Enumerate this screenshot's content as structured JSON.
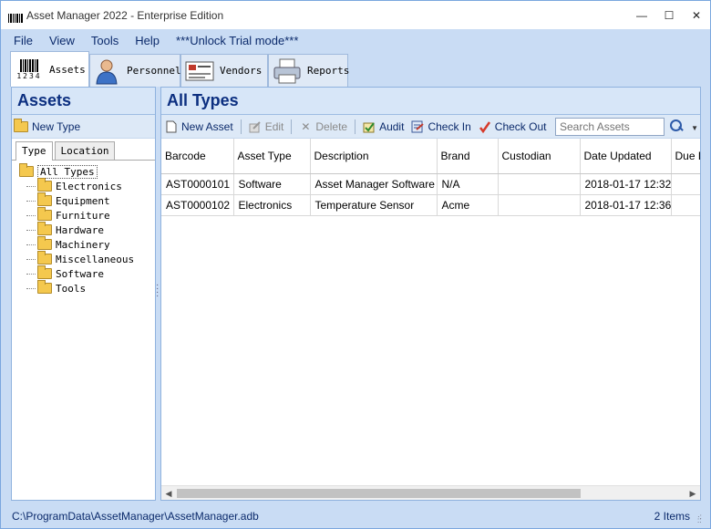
{
  "window": {
    "title": "Asset Manager 2022 - Enterprise Edition",
    "controls": {
      "minimize": "—",
      "maximize": "☐",
      "close": "✕"
    }
  },
  "menu": [
    "File",
    "View",
    "Tools",
    "Help",
    "***Unlock Trial mode***"
  ],
  "main_tabs": [
    {
      "label": "Assets",
      "icon": "barcode-icon",
      "active": true,
      "icon_text": "1234"
    },
    {
      "label": "Personnel",
      "icon": "person-icon",
      "active": false
    },
    {
      "label": "Vendors",
      "icon": "vendor-card-icon",
      "active": false
    },
    {
      "label": "Reports",
      "icon": "printer-icon",
      "active": false
    }
  ],
  "left_pane": {
    "title": "Assets",
    "new_type_label": "New Type",
    "subtabs": [
      {
        "label": "Type",
        "active": true
      },
      {
        "label": "Location",
        "active": false
      }
    ],
    "tree": {
      "root": "All Types",
      "children": [
        "Electronics",
        "Equipment",
        "Furniture",
        "Hardware",
        "Machinery",
        "Miscellaneous",
        "Software",
        "Tools"
      ]
    }
  },
  "right_pane": {
    "title": "All Types",
    "toolbar": {
      "new_asset": "New Asset",
      "edit": "Edit",
      "delete": "Delete",
      "audit": "Audit",
      "check_in": "Check In",
      "check_out": "Check Out",
      "search_placeholder": "Search Assets"
    },
    "columns": [
      "Barcode",
      "Asset Type",
      "Description",
      "Brand",
      "Custodian",
      "Date Updated",
      "Due D"
    ],
    "rows": [
      [
        "AST0000101",
        "Software",
        "Asset Manager Software",
        "N/A",
        "",
        "2018-01-17 12:32",
        ""
      ],
      [
        "AST0000102",
        "Electronics",
        "Temperature Sensor",
        "Acme",
        "",
        "2018-01-17 12:36",
        ""
      ]
    ]
  },
  "status": {
    "path": "C:\\ProgramData\\AssetManager\\AssetManager.adb",
    "count": "2 Items"
  },
  "colors": {
    "chrome": "#c9dcf4",
    "header_text": "#0c2f80",
    "panel_border": "#8fb2de"
  }
}
